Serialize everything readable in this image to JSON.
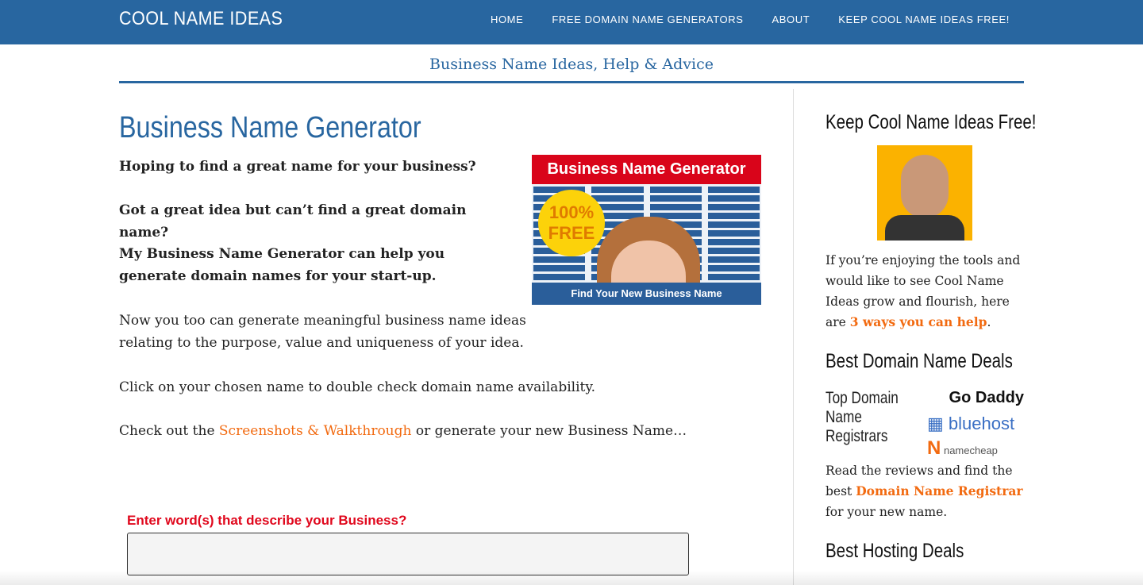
{
  "header": {
    "logo": "COOL NAME IDEAS",
    "nav": [
      "HOME",
      "FREE DOMAIN NAME GENERATORS",
      "ABOUT",
      "KEEP COOL NAME IDEAS FREE!"
    ]
  },
  "tagline": "Business Name Ideas, Help & Advice",
  "main": {
    "title": "Business Name Generator",
    "q1": "Hoping to find a great name for your business?",
    "q2": "Got a great idea but can’t find a great domain name?",
    "q3": "My Business Name Generator can help you generate domain names for your start-up.",
    "p1": "Now you too can generate meaningful business name ideas relating to the purpose, value and uniqueness of your idea.",
    "p2": "Click on your chosen name to double check domain name availability.",
    "p3_before": "Check out the ",
    "p3_link": "Screenshots & Walkthrough",
    "p3_after": " or generate your new Business Name…",
    "promo": {
      "title": "Business Name Generator",
      "badge1": "100%",
      "badge2": "FREE",
      "footer": "Find Your New Business Name"
    },
    "input_label": "Enter word(s) that describe your Business?",
    "input_value": ""
  },
  "sidebar": {
    "h1": "Keep Cool Name Ideas Free!",
    "text1": "If you’re enjoying the tools and would like to see Cool Name Ideas grow and flourish, here are ",
    "link1": "3 ways you can help",
    "dot": ".",
    "h2": "Best Domain Name Deals",
    "registrars": "Top Domain Name Registrars",
    "logos": [
      "Go Daddy",
      "bluehost",
      "namecheap"
    ],
    "text2": "Read the reviews and find the best ",
    "link2": "Domain Name Registrar",
    "text2b": " for your new name.",
    "h3": "Best Hosting Deals"
  },
  "colors": {
    "brand": "#2866a0",
    "link": "#f26a10",
    "label": "#e0081d"
  }
}
